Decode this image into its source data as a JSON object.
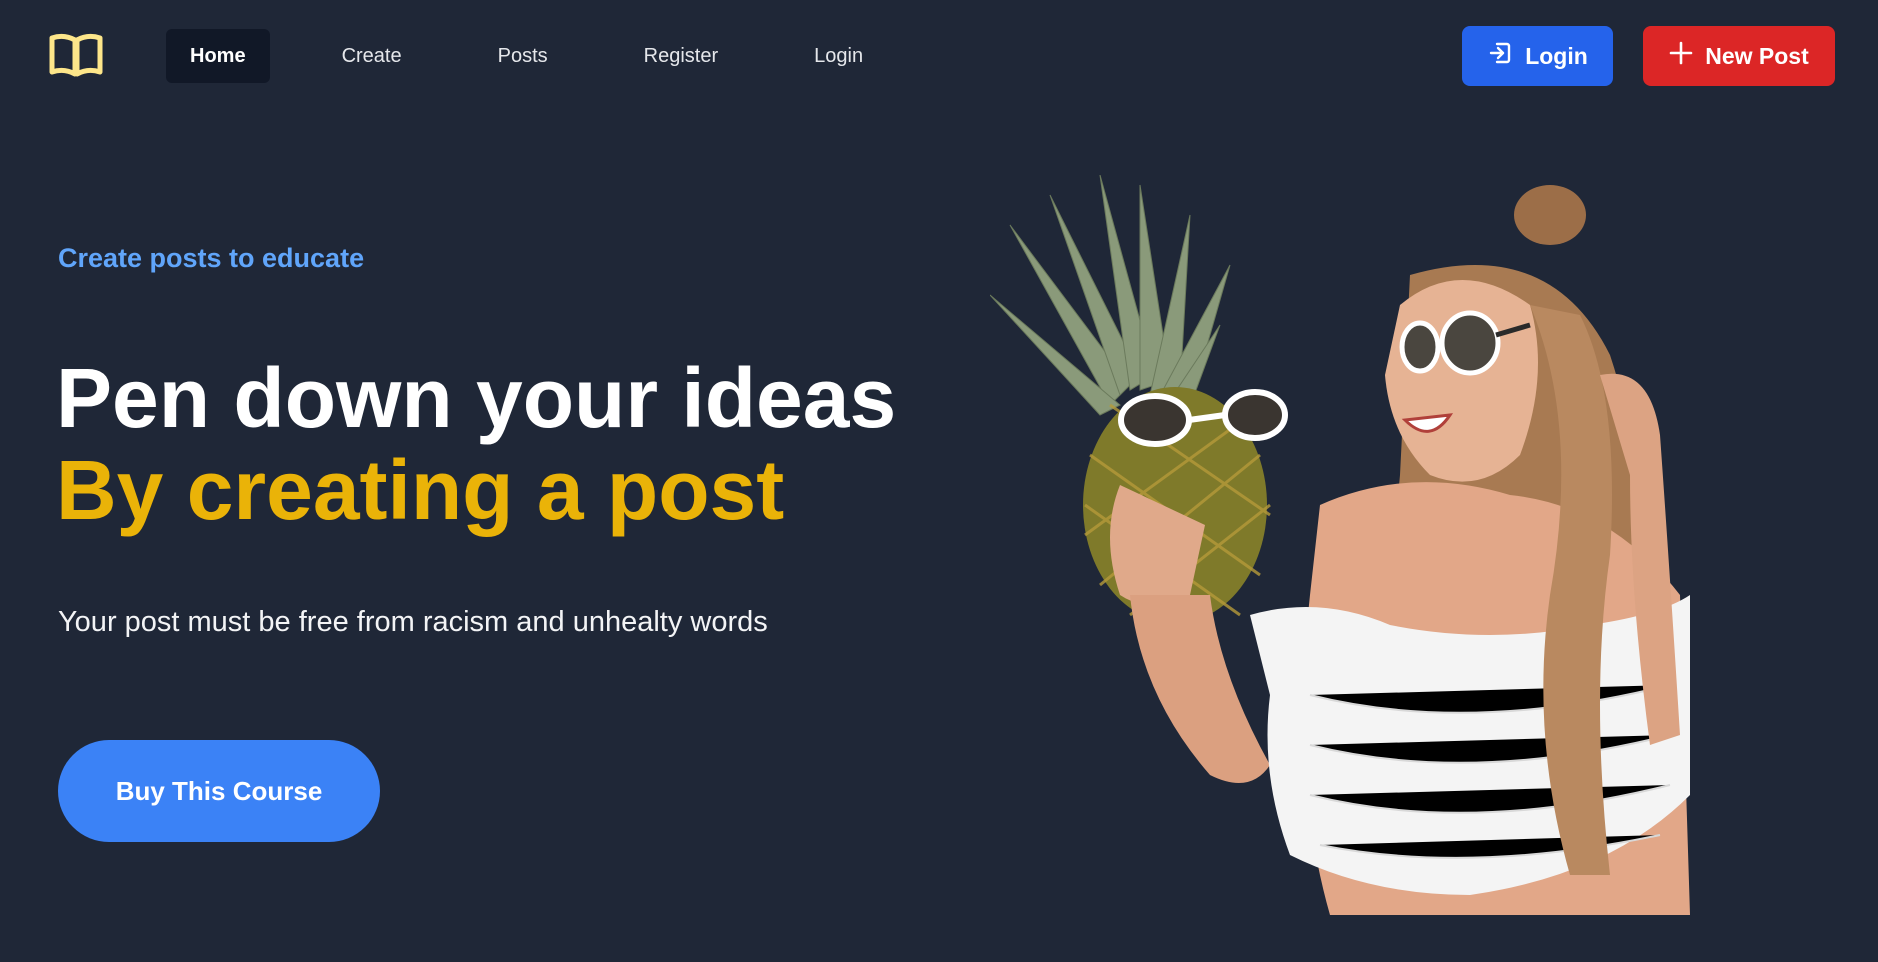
{
  "nav": {
    "logo_icon": "book-open-icon",
    "links": [
      {
        "label": "Home",
        "active": true
      },
      {
        "label": "Create",
        "active": false
      },
      {
        "label": "Posts",
        "active": false
      },
      {
        "label": "Register",
        "active": false
      },
      {
        "label": "Login",
        "active": false
      }
    ],
    "login_button": {
      "label": "Login",
      "icon": "login-icon"
    },
    "new_post_button": {
      "label": "New Post",
      "icon": "plus-icon"
    }
  },
  "hero": {
    "eyebrow": "Create posts to educate",
    "headline_line1": "Pen down your ideas",
    "headline_line2": "By creating a post",
    "subtitle": "Your post must be free from racism and unhealty words",
    "cta_label": "Buy This Course"
  },
  "colors": {
    "background": "#1f2737",
    "accent_blue": "#3b82f6",
    "accent_yellow": "#eab308",
    "danger_red": "#dc2626",
    "eyebrow_blue": "#60a5fa"
  }
}
